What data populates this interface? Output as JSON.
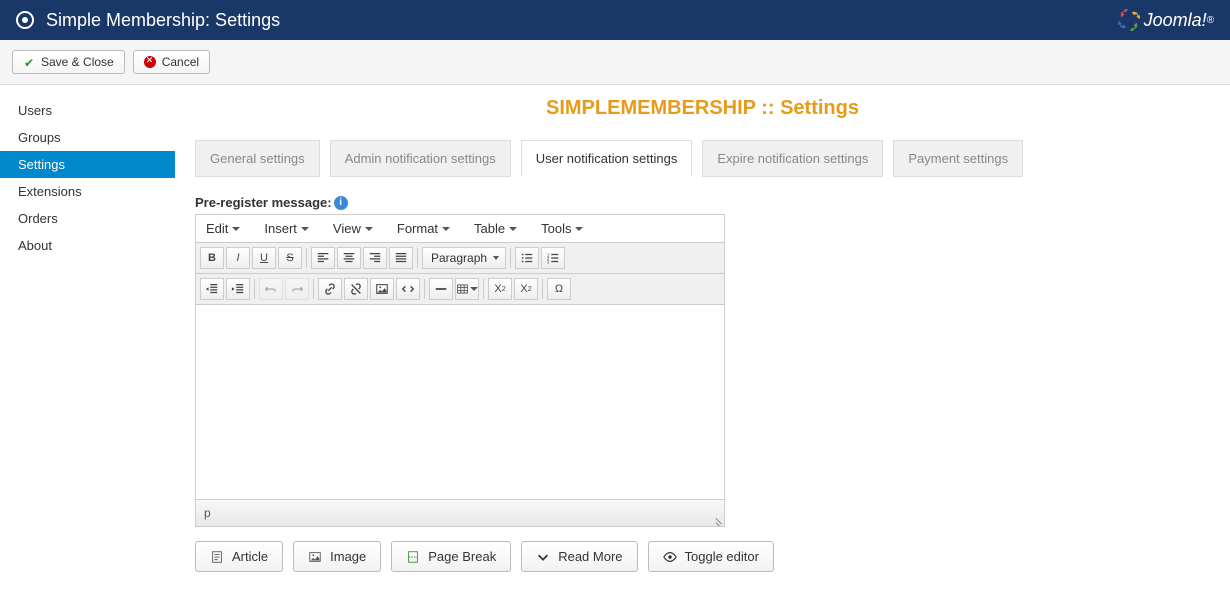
{
  "header": {
    "title": "Simple Membership: Settings",
    "brand": "Joomla!"
  },
  "toolbar": {
    "save_close": "Save & Close",
    "cancel": "Cancel"
  },
  "sidebar": {
    "items": [
      {
        "label": "Users",
        "active": false
      },
      {
        "label": "Groups",
        "active": false
      },
      {
        "label": "Settings",
        "active": true
      },
      {
        "label": "Extensions",
        "active": false
      },
      {
        "label": "Orders",
        "active": false
      },
      {
        "label": "About",
        "active": false
      }
    ]
  },
  "page_heading": "SIMPLEMEMBERSHIP :: Settings",
  "tabs": [
    {
      "label": "General settings",
      "active": false
    },
    {
      "label": "Admin notification settings",
      "active": false
    },
    {
      "label": "User notification settings",
      "active": true
    },
    {
      "label": "Expire notification settings",
      "active": false
    },
    {
      "label": "Payment settings",
      "active": false
    }
  ],
  "field": {
    "label": "Pre-register message:"
  },
  "editor": {
    "menus": [
      "Edit",
      "Insert",
      "View",
      "Format",
      "Table",
      "Tools"
    ],
    "para_select": "Paragraph",
    "status_path": "p",
    "content": ""
  },
  "actions": {
    "article": "Article",
    "image": "Image",
    "pagebreak": "Page Break",
    "readmore": "Read More",
    "toggle": "Toggle editor"
  }
}
